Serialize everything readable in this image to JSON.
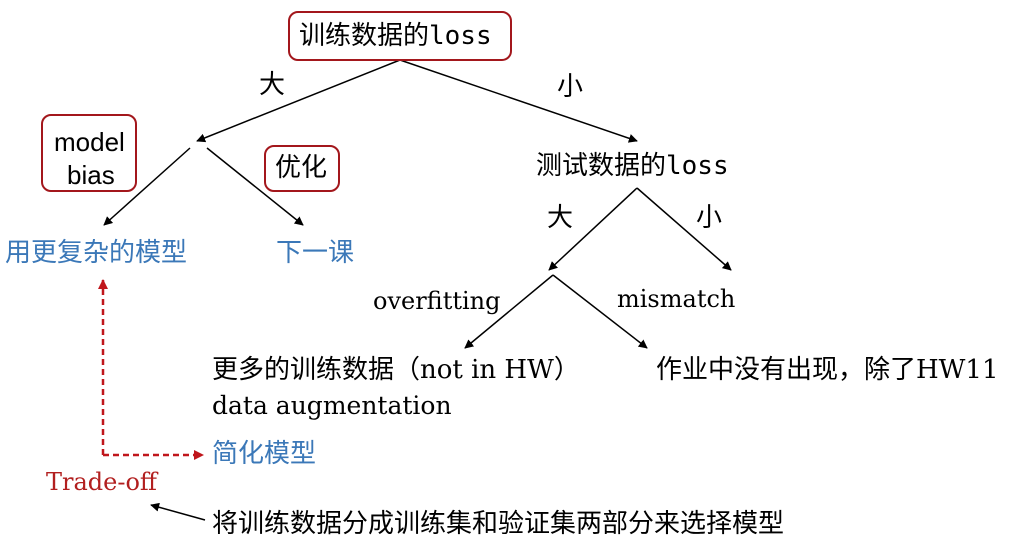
{
  "diagram": {
    "root": "训练数据的loss",
    "root_left_edge": "大",
    "root_right_edge": "小",
    "large_train_loss": {
      "model_bias": [
        "model",
        "bias"
      ],
      "optimization": "优化",
      "model_bias_fix": "用更复杂的模型",
      "optimization_next": "下一课"
    },
    "small_train_loss": {
      "node": "测试数据的loss",
      "left_edge": "大",
      "right_edge": "小",
      "overfitting_label": "overfitting",
      "mismatch_label": "mismatch",
      "overfitting_fix": [
        "更多的训练数据（not in HW）",
        "data augmentation"
      ],
      "mismatch_note": "作业中没有出现，除了HW11"
    },
    "simplify_model": "简化模型",
    "trade_off": "Trade-off",
    "validation_note": "将训练数据分成训练集和验证集两部分来选择模型"
  },
  "colors": {
    "blue_text": "#3b78b8",
    "red_box": "#a3171c",
    "red_text": "#b21f1f",
    "dashed_arrow": "#c0161c"
  }
}
